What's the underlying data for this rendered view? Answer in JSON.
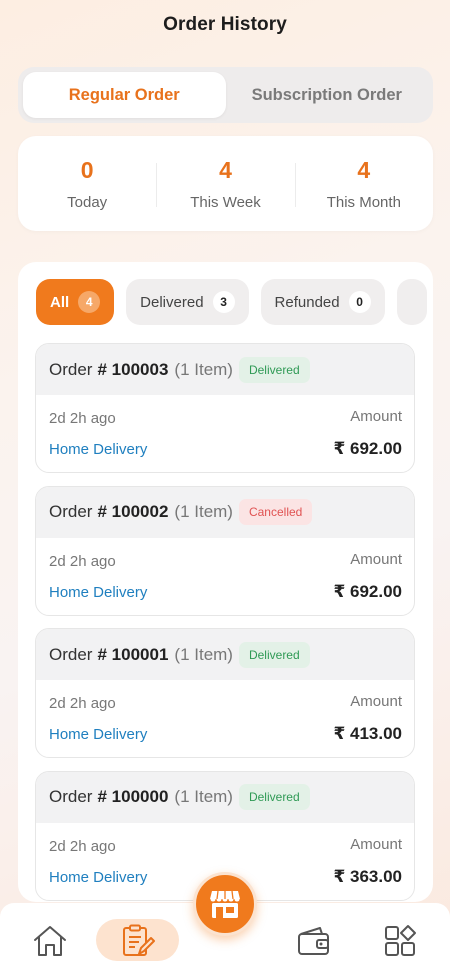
{
  "header": {
    "title": "Order History"
  },
  "segments": [
    {
      "label": "Regular Order",
      "active": true
    },
    {
      "label": "Subscription Order",
      "active": false
    }
  ],
  "stats": [
    {
      "value": "0",
      "label": "Today"
    },
    {
      "value": "4",
      "label": "This Week"
    },
    {
      "value": "4",
      "label": "This Month"
    }
  ],
  "filters": [
    {
      "label": "All",
      "count": "4",
      "active": true
    },
    {
      "label": "Delivered",
      "count": "3",
      "active": false
    },
    {
      "label": "Refunded",
      "count": "0",
      "active": false
    }
  ],
  "orders": [
    {
      "prefix": "Order",
      "hash": "#",
      "number": "100003",
      "items": "(1 Item)",
      "status": "Delivered",
      "ago": "2d 2h ago",
      "delivery": "Home Delivery",
      "amount_label": "Amount",
      "amount": "₹ 692.00"
    },
    {
      "prefix": "Order",
      "hash": "#",
      "number": "100002",
      "items": "(1 Item)",
      "status": "Cancelled",
      "ago": "2d 2h ago",
      "delivery": "Home Delivery",
      "amount_label": "Amount",
      "amount": "₹ 692.00"
    },
    {
      "prefix": "Order",
      "hash": "#",
      "number": "100001",
      "items": "(1 Item)",
      "status": "Delivered",
      "ago": "2d 2h ago",
      "delivery": "Home Delivery",
      "amount_label": "Amount",
      "amount": "₹ 413.00"
    },
    {
      "prefix": "Order",
      "hash": "#",
      "number": "100000",
      "items": "(1 Item)",
      "status": "Delivered",
      "ago": "2d 2h ago",
      "delivery": "Home Delivery",
      "amount_label": "Amount",
      "amount": "₹ 363.00"
    }
  ],
  "nav": {
    "items": [
      "home-icon",
      "orders-icon",
      "store-icon",
      "wallet-icon",
      "menu-grid-icon"
    ],
    "active": "orders-icon",
    "accent": "#f07a1d"
  },
  "colors": {
    "accent": "#e8721c",
    "delivered": "#2f9a55",
    "cancelled": "#e05252",
    "link": "#1f7fbf"
  }
}
